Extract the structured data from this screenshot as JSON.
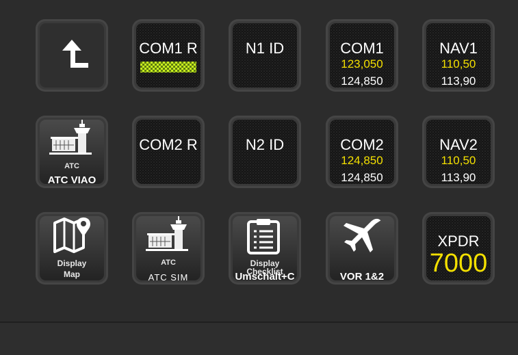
{
  "keys": {
    "back": {
      "icon": "return-arrow-icon"
    },
    "com1r": {
      "title": "COM1 R"
    },
    "n1id": {
      "title": "N1 ID"
    },
    "com1": {
      "title": "COM1",
      "active": "123,050",
      "standby": "124,850"
    },
    "nav1": {
      "title": "NAV1",
      "active": "110,50",
      "standby": "113,90"
    },
    "atc_viao": {
      "caption": "ATC",
      "label": "ATC VIAO",
      "icon": "control-tower-icon"
    },
    "com2r": {
      "title": "COM2 R"
    },
    "n2id": {
      "title": "N2 ID"
    },
    "com2": {
      "title": "COM2",
      "active": "124,850",
      "standby": "124,850"
    },
    "nav2": {
      "title": "NAV2",
      "active": "110,50",
      "standby": "113,90"
    },
    "display_map": {
      "caption_line1": "Display",
      "caption_line2": "Map",
      "icon": "map-pin-icon"
    },
    "atc_sim": {
      "caption": "ATC",
      "label": "ATC SIM",
      "icon": "control-tower-icon"
    },
    "checklist": {
      "caption_line1": "Display",
      "caption_line2": "Checklist",
      "label": "Umschalt+C",
      "icon": "clipboard-checklist-icon"
    },
    "vor": {
      "label": "VOR 1&2",
      "icon": "airplane-icon"
    },
    "xpdr": {
      "title": "XPDR",
      "code": "7000"
    }
  },
  "colors": {
    "accent_yellow": "#f4e000",
    "meter_green": "#c7ef1f",
    "background": "#2c2c2c"
  }
}
